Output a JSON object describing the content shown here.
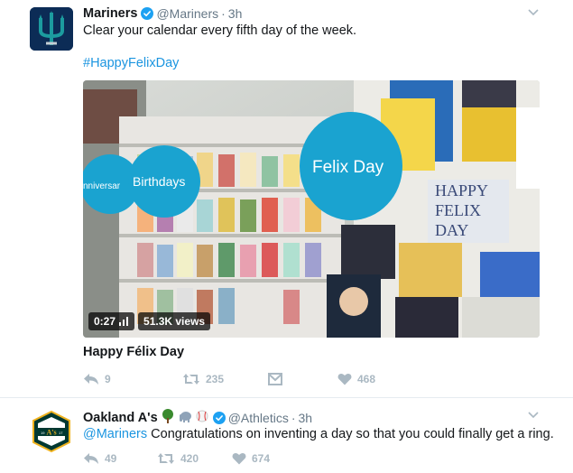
{
  "tweets": [
    {
      "name": "Mariners",
      "handle": "@Mariners",
      "time": "3h",
      "text": "Clear your calendar every fifth day of the week.",
      "hashtag": "#HappyFelixDay",
      "media": {
        "duration": "0:27",
        "views": "51.3K views",
        "sign_felix": "Felix Day",
        "sign_birthdays": "Birthdays",
        "sign_anniversary": "nniversar",
        "card_happy": "HAPPY FELIX DAY"
      },
      "card_title": "Happy Félix Day",
      "replies": "9",
      "retweets": "235",
      "likes": "468"
    },
    {
      "name": "Oakland A's",
      "handle": "@Athletics",
      "time": "3h",
      "emoji": [
        "tree-emoji",
        "elephant-emoji",
        "baseball-emoji"
      ],
      "mention": "@Mariners",
      "text": "Congratulations on inventing a day so that you could finally get a ring.",
      "replies": "49",
      "retweets": "420",
      "likes": "674"
    }
  ],
  "colors": {
    "link": "#1b95e0",
    "muted": "#657786",
    "action": "#aab8c2",
    "verified": "#1da1f2",
    "mariners_navy": "#0c2c56",
    "mariners_teal": "#1c9c9f",
    "athletics_green": "#003831",
    "athletics_gold": "#efb21e",
    "sign_blue": "#1aa3d0"
  }
}
